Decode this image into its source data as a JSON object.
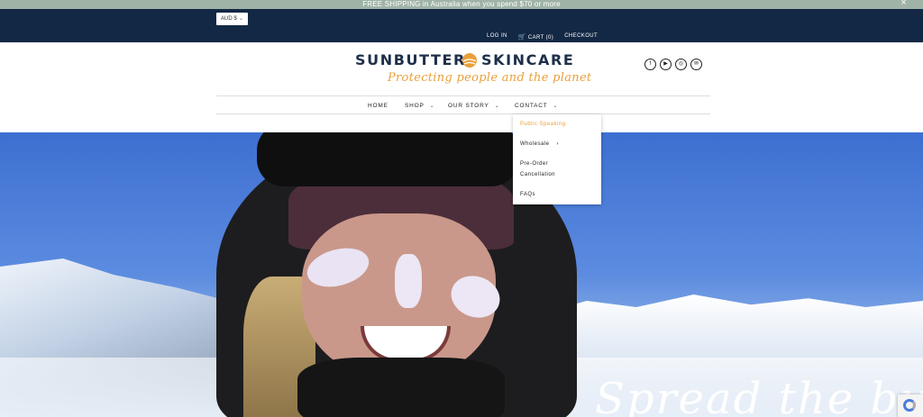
{
  "announcement": {
    "text": "FREE SHIPPING in Australia when you spend $70 or more",
    "close": "×"
  },
  "topbar": {
    "currency": "AUD $",
    "links": {
      "login": "LOG IN",
      "cart": "CART (0)",
      "checkout": "CHECKOUT"
    }
  },
  "brand": {
    "name_left": "SUNBUTTER",
    "name_right": "SKINCARE",
    "tagline": "Protecting people and the planet",
    "accent_color": "#e8a03a",
    "navy_color": "#132844"
  },
  "social": [
    "facebook-icon",
    "youtube-icon",
    "instagram-icon",
    "email-icon"
  ],
  "nav": {
    "home": "HOME",
    "shop": "SHOP",
    "our_story": "OUR STORY",
    "contact": "CONTACT"
  },
  "contact_menu": {
    "public_speaking": "Public Speaking",
    "wholesale": "Wholesale",
    "preorder_line1": "Pre-Order",
    "preorder_line2": "Cancellation",
    "faqs": "FAQs"
  },
  "hero": {
    "script_text": "Spread the butter"
  }
}
